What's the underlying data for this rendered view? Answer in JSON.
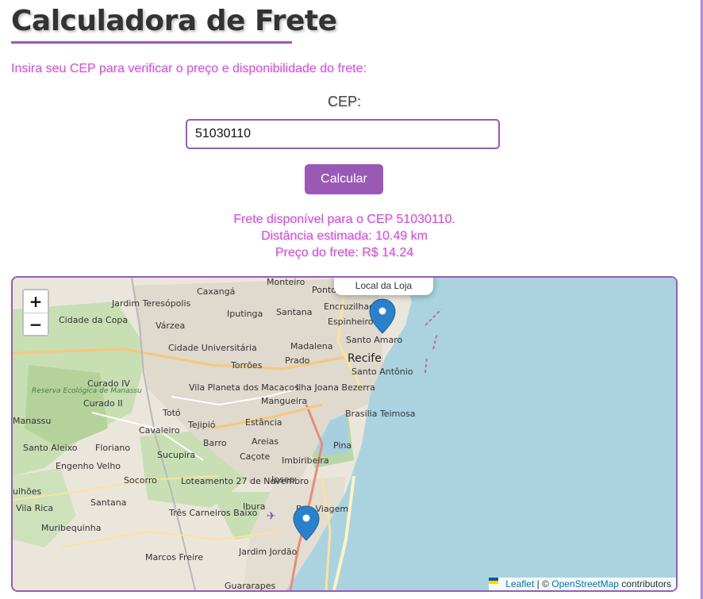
{
  "page": {
    "title": "Calculadora de Frete",
    "intro": "Insira seu CEP para verificar o preço e disponibilidade do frete:"
  },
  "form": {
    "cep_label": "CEP:",
    "cep_value": "51030110",
    "button_label": "Calcular"
  },
  "result": {
    "line1": "Frete disponível para o CEP 51030110.",
    "line2": "Distância estimada: 10.49 km",
    "line3": "Preço do frete: R$ 14.24"
  },
  "map": {
    "zoom_in": "+",
    "zoom_out": "−",
    "popup_text": "Local da Loja",
    "attribution": {
      "leaflet": "Leaflet",
      "separator": " | © ",
      "osm": "OpenStreetMap",
      "suffix": " contributors"
    },
    "labels": {
      "l0": "Monteiro",
      "l1": "Caxangá",
      "l2": "Ponto",
      "l3": "Jardim Teresópolis",
      "l4": "Encruzilhada",
      "l5": "Iputinga",
      "l6": "Santana",
      "l7": "Cidade da Copa",
      "l8": "Várzea",
      "l9": "Espinheiro",
      "l10": "Madalena",
      "l11": "Santo Amaro",
      "l12": "Cidade Universitária",
      "l13": "Recife",
      "l14": "Prado",
      "l15": "Torrões",
      "l16": "Santo Antônio",
      "l17": "Curado IV",
      "l18": "Ilha Joana Bezerra",
      "l19": "Vila Planeta dos Macacos",
      "l20": "Reserva Ecológica de Manassu",
      "l21": "Mangueira",
      "l22": "Curado II",
      "l23": "Brasília Teimosa",
      "l24": "Totó",
      "l25": "Estância",
      "l26": "Manassu",
      "l27": "Cavaleiro",
      "l28": "Tejipió",
      "l29": "Santo Aleixo",
      "l30": "Floriano",
      "l31": "Barro",
      "l32": "Areias",
      "l33": "Pina",
      "l34": "Engenho Velho",
      "l35": "Sucupira",
      "l36": "Caçote",
      "l37": "Imbiribeira",
      "l38": "Socorro",
      "l39": "Loteamento 27 de Novembro",
      "l40": "Ipsep",
      "l41": "ulhões",
      "l42": "Vila Rica",
      "l43": "Santana",
      "l44": "Ibura",
      "l45": "Boa Viagem",
      "l46": "Muribequinha",
      "l47": "Três Carneiros Baixo",
      "l48": "Jardim Jordão",
      "l49": "Marcos Freire",
      "l50": "Guararapes"
    }
  },
  "colors": {
    "accent": "#9b59b6",
    "result_text": "#d94fe0",
    "sea": "#aad3df",
    "marker": "#2a81cb"
  }
}
